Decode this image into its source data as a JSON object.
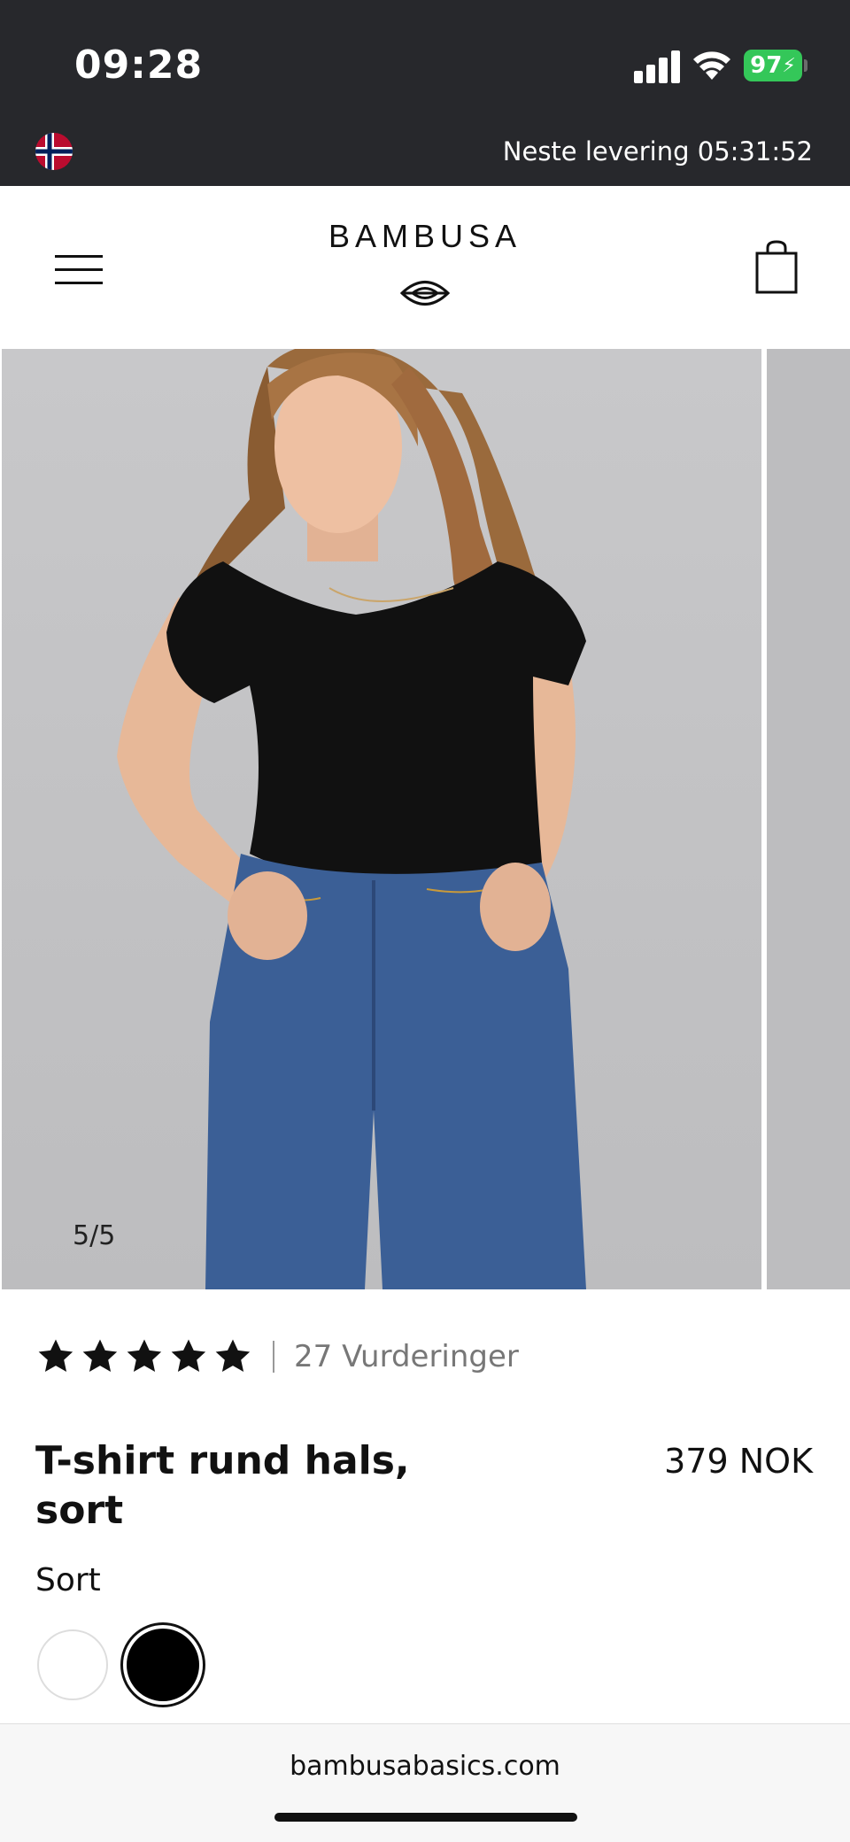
{
  "status_bar": {
    "time": "09:28",
    "battery_percent": "97"
  },
  "delivery_bar": {
    "text": "Neste levering 05:31:52",
    "flag_icon": "norway-flag-icon"
  },
  "header": {
    "brand": "BAMBUSA",
    "menu_icon": "hamburger-menu-icon",
    "cart_icon": "shopping-bag-icon"
  },
  "gallery": {
    "counter": "5/5"
  },
  "product": {
    "rating_stars": 5,
    "reviews_label": "27 Vurderinger",
    "title": "T-shirt rund hals, sort",
    "price": "379 NOK",
    "color_label": "Sort",
    "swatches": [
      {
        "name": "white",
        "color": "#ffffff",
        "selected": false
      },
      {
        "name": "black",
        "color": "#000000",
        "selected": true
      }
    ]
  },
  "browser": {
    "url": "bambusabasics.com"
  },
  "colors": {
    "status_bg": "#27282c",
    "battery_green": "#34c759"
  }
}
